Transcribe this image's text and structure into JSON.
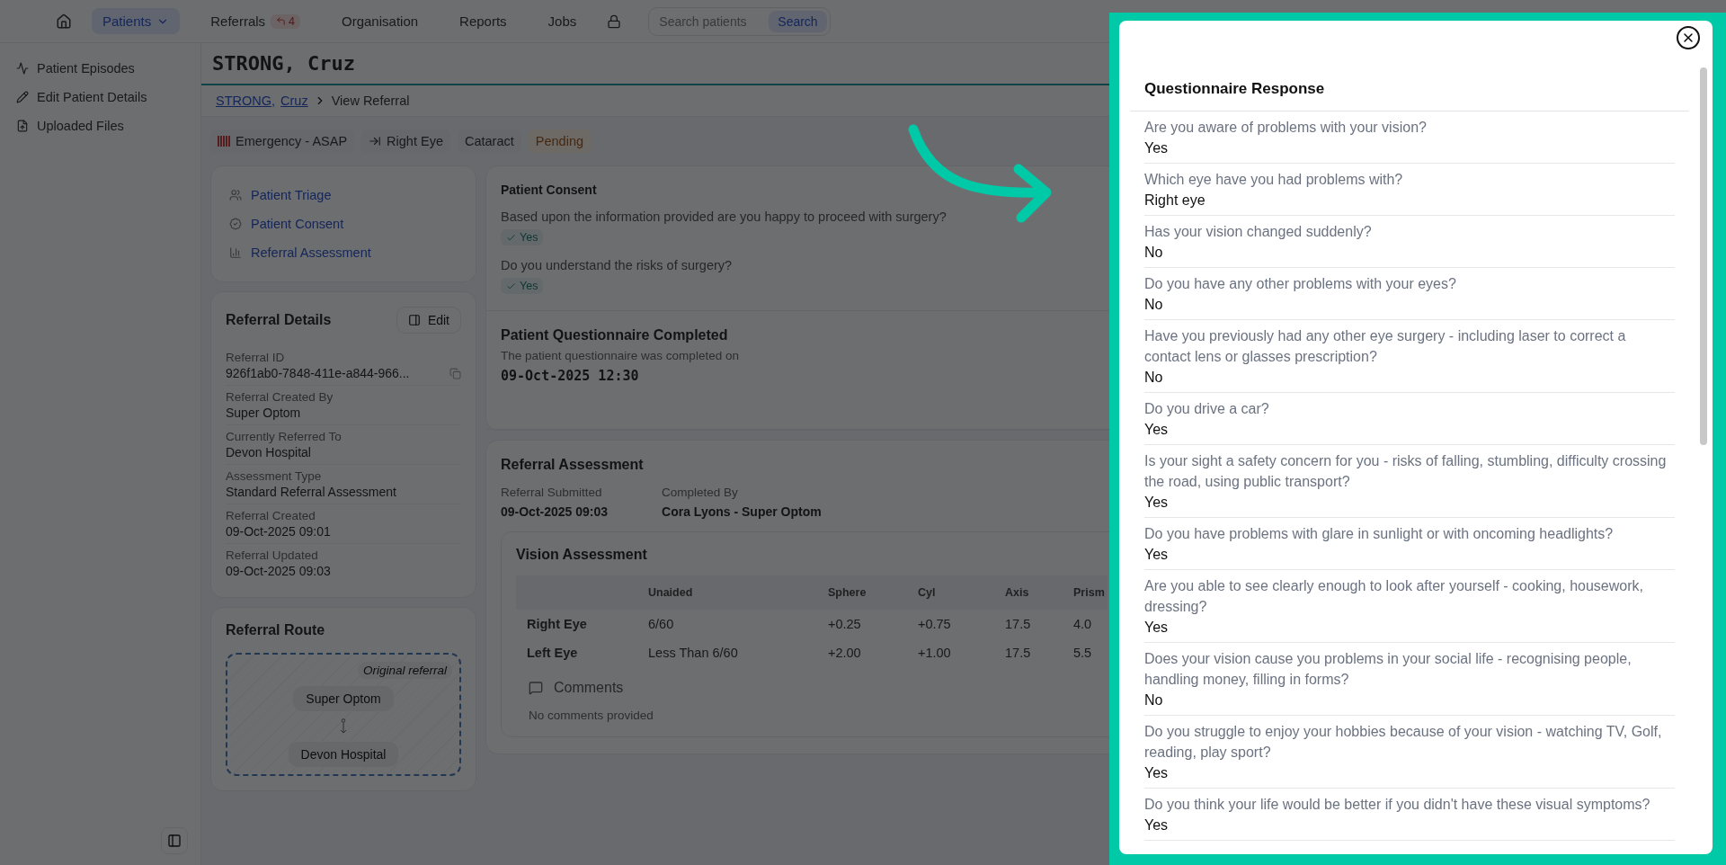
{
  "nav": {
    "items": [
      {
        "label": "Patients",
        "selected": true,
        "kind": "dropdown"
      },
      {
        "label": "Referrals",
        "selected": false,
        "kind": "badge",
        "badge": "4"
      },
      {
        "label": "Organisation",
        "selected": false,
        "kind": "plain"
      },
      {
        "label": "Reports",
        "selected": false,
        "kind": "plain"
      },
      {
        "label": "Jobs",
        "selected": false,
        "kind": "plain"
      }
    ],
    "search": {
      "placeholder": "Search patients",
      "button": "Search"
    }
  },
  "sidebar": {
    "items": [
      {
        "label": "Patient Episodes",
        "kind": "pulse"
      },
      {
        "label": "Edit Patient Details",
        "kind": "pencil"
      },
      {
        "label": "Uploaded Files",
        "kind": "file"
      }
    ]
  },
  "patient_name": "STRONG, Cruz",
  "breadcrumb": {
    "links": [
      "STRONG,",
      "Cruz"
    ],
    "current": "View Referral"
  },
  "tags": [
    {
      "label": "Emergency - ASAP",
      "kind": "urgency"
    },
    {
      "label": "Right Eye",
      "kind": "eye"
    },
    {
      "label": "Cataract",
      "kind": "plain"
    },
    {
      "label": "Pending",
      "kind": "status"
    }
  ],
  "steps": [
    {
      "label": "Patient Triage",
      "kind": "person"
    },
    {
      "label": "Patient Consent",
      "kind": "check"
    },
    {
      "label": "Referral Assessment",
      "kind": "chart"
    }
  ],
  "referral_details": {
    "title": "Referral Details",
    "edit": "Edit",
    "fields": [
      {
        "label": "Referral ID",
        "value": "926f1ab0-7848-411e-a844-966...",
        "copy": true
      },
      {
        "label": "Referral Created By",
        "value": "Super Optom",
        "copy": false
      },
      {
        "label": "Currently Referred To",
        "value": "Devon Hospital",
        "copy": false
      },
      {
        "label": "Assessment Type",
        "value": "Standard Referral Assessment",
        "copy": false
      },
      {
        "label": "Referral Created",
        "value": "09-Oct-2025 09:01",
        "copy": false
      },
      {
        "label": "Referral Updated",
        "value": "09-Oct-2025 09:03",
        "copy": false
      }
    ]
  },
  "referral_route": {
    "title": "Referral Route",
    "tag": "Original referral",
    "nodes": [
      "Super Optom",
      "Devon Hospital"
    ]
  },
  "consent": {
    "title": "Patient Consent",
    "questions": [
      {
        "question": "Based upon the information provided are you happy to proceed with surgery?",
        "answer": "Yes"
      },
      {
        "question": "Do you understand the risks of surgery?",
        "answer": "Yes"
      }
    ]
  },
  "questionnaire_completed": {
    "title": "Patient Questionnaire Completed",
    "text": "The patient questionnaire was completed on",
    "date": "09-Oct-2025 12:30"
  },
  "referral_assessment": {
    "title": "Referral Assessment",
    "meta": [
      {
        "label": "Referral Submitted",
        "value": "09-Oct-2025 09:03"
      },
      {
        "label": "Completed By",
        "value": "Cora Lyons - Super Optom"
      }
    ],
    "vision": {
      "title": "Vision Assessment",
      "columns": [
        "Unaided",
        "Sphere",
        "Cyl",
        "Axis",
        "Prism"
      ],
      "rows": [
        {
          "eye": "Right Eye",
          "cells": [
            "6/60",
            "+0.25",
            "+0.75",
            "17.5",
            "4.0"
          ]
        },
        {
          "eye": "Left Eye",
          "cells": [
            "Less Than 6/60",
            "+2.00",
            "+1.00",
            "17.5",
            "5.5"
          ]
        }
      ]
    },
    "comments": {
      "title": "Comments",
      "text": "No comments provided"
    }
  },
  "drawer": {
    "title": "Questionnaire Response",
    "responses": [
      {
        "question": "Are you aware of problems with your vision?",
        "answer": "Yes"
      },
      {
        "question": "Which eye have you had problems with?",
        "answer": "Right eye"
      },
      {
        "question": "Has your vision changed suddenly?",
        "answer": "No"
      },
      {
        "question": "Do you have any other problems with your eyes?",
        "answer": "No"
      },
      {
        "question": "Have you previously had any other eye surgery - including laser to correct a contact lens or glasses prescription?",
        "answer": "No"
      },
      {
        "question": "Do you drive a car?",
        "answer": "Yes"
      },
      {
        "question": "Is your sight a safety concern for you - risks of falling, stumbling, difficulty crossing the road, using public transport?",
        "answer": "Yes"
      },
      {
        "question": "Do you have problems with glare in sunlight or with oncoming headlights?",
        "answer": "Yes"
      },
      {
        "question": "Are you able to see clearly enough to look after yourself - cooking, housework, dressing?",
        "answer": "Yes"
      },
      {
        "question": "Does your vision cause you problems in your social life - recognising people, handling money, filling in forms?",
        "answer": "No"
      },
      {
        "question": "Do you struggle to enjoy your hobbies because of your vision - watching TV, Golf, reading, play sport?",
        "answer": "Yes"
      },
      {
        "question": "Do you think your life would be better if you didn't have these visual symptoms?",
        "answer": "Yes"
      }
    ]
  }
}
